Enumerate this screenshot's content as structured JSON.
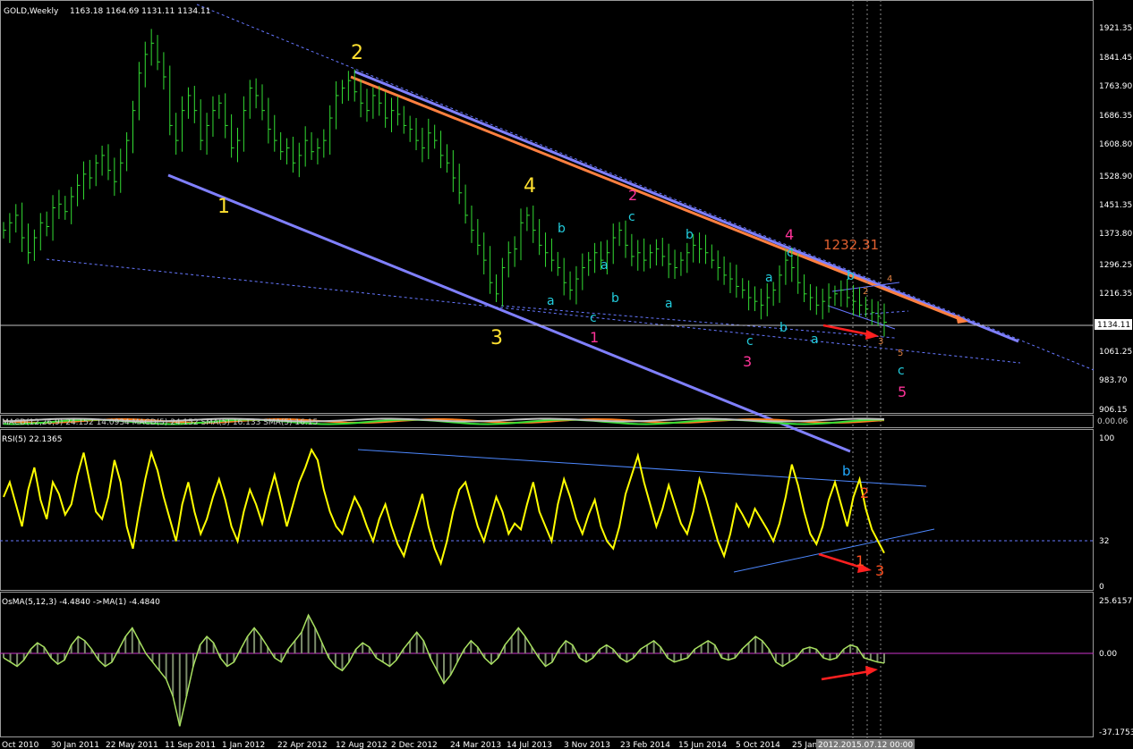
{
  "header": {
    "symbol": "GOLD,Weekly",
    "ohlc": "1163.18 1164.69 1131.11 1134.11"
  },
  "price_axis": {
    "ticks": [
      "1921.35",
      "1841.45",
      "1763.90",
      "1686.35",
      "1608.80",
      "1528.90",
      "1451.35",
      "1373.80",
      "1296.25",
      "1216.35",
      "1134.11",
      "1061.25",
      "983.70",
      "906.15"
    ],
    "current": "1134.11"
  },
  "price_annotation": "1232.31",
  "macd": {
    "label": "MACD(12,26,9) 24.152 14.0934 MACD(5) 24.152 SMA(5) 16.133 SMA(5) 16.15",
    "right_label": "0.00.06"
  },
  "rsi": {
    "label": "RSI(5) 22.1365",
    "ticks": [
      "100",
      "32",
      "0"
    ]
  },
  "osma": {
    "label": "OsMA(5,12,3) -4.4840 ->MA(1) -4.4840",
    "ticks": [
      "25.6157",
      "0.00",
      "-37.1753"
    ]
  },
  "x_axis": {
    "ticks": [
      "Oct 2010",
      "30 Jan 2011",
      "22 May 2011",
      "11 Sep 2011",
      "1 Jan 2012",
      "22 Apr 2012",
      "12 Aug 2012",
      "2 Dec 2012",
      "24 Mar 2013",
      "14 Jul 2013",
      "3 Nov 2013",
      "23 Feb 2014",
      "15 Jun 2014",
      "5 Oct 2014",
      "25 Jan",
      "2012.2015.07.12 00:00"
    ]
  },
  "wave_labels": {
    "yellow": [
      "1",
      "2",
      "3",
      "4"
    ],
    "magenta": [
      "1",
      "2",
      "3",
      "4",
      "5"
    ],
    "cyan": [
      "a",
      "b",
      "c",
      "a",
      "b",
      "c",
      "a",
      "b",
      "c",
      "a",
      "b",
      "c",
      "a",
      "b",
      "c",
      "b",
      "c"
    ],
    "orange": [
      "2",
      "3",
      "4",
      "5"
    ],
    "rsi": [
      "b",
      "2",
      "1",
      "3"
    ]
  },
  "colors": {
    "background": "#000000",
    "candles": "#33dd33",
    "channel": "#8080ff",
    "orange_line": "#ff8040",
    "rsi_line": "#ffff00",
    "osma_line": "#a8e060",
    "yellow_label": "#ffe030",
    "magenta_label": "#ff3399",
    "cyan_label": "#22ccdd",
    "arrow": "#ff2020"
  },
  "chart_data": [
    {
      "type": "candlestick",
      "title": "GOLD,Weekly",
      "y_range": [
        906.15,
        1921.35
      ],
      "series_name": "GOLD,Weekly",
      "closes": [
        1380,
        1400,
        1420,
        1360,
        1320,
        1360,
        1400,
        1390,
        1440,
        1450,
        1430,
        1470,
        1500,
        1530,
        1520,
        1560,
        1580,
        1540,
        1510,
        1560,
        1620,
        1700,
        1800,
        1850,
        1880,
        1830,
        1790,
        1660,
        1620,
        1700,
        1740,
        1700,
        1620,
        1660,
        1700,
        1720,
        1660,
        1600,
        1620,
        1700,
        1760,
        1740,
        1700,
        1650,
        1620,
        1590,
        1600,
        1560,
        1580,
        1620,
        1590,
        1600,
        1620,
        1680,
        1740,
        1760,
        1780,
        1750,
        1720,
        1700,
        1740,
        1720,
        1680,
        1700,
        1690,
        1660,
        1650,
        1620,
        1600,
        1640,
        1620,
        1580,
        1560,
        1520,
        1480,
        1420,
        1380,
        1340,
        1300,
        1240,
        1210,
        1280,
        1320,
        1330,
        1400,
        1420,
        1380,
        1340,
        1320,
        1300,
        1280,
        1240,
        1220,
        1250,
        1280,
        1300,
        1320,
        1300,
        1320,
        1360,
        1380,
        1340,
        1310,
        1320,
        1300,
        1320,
        1330,
        1310,
        1290,
        1280,
        1300,
        1320,
        1340,
        1330,
        1320,
        1300,
        1280,
        1260,
        1250,
        1230,
        1220,
        1200,
        1190,
        1180,
        1200,
        1220,
        1260,
        1300,
        1280,
        1240,
        1210,
        1200,
        1180,
        1190,
        1200,
        1210,
        1220,
        1200,
        1190,
        1180,
        1170,
        1160,
        1150,
        1134.11
      ]
    },
    {
      "type": "line",
      "title": "RSI(5) 22.1365",
      "y_range": [
        0,
        100
      ],
      "series_name": "RSI(5)",
      "values": [
        60,
        70,
        55,
        40,
        65,
        80,
        58,
        45,
        70,
        62,
        48,
        55,
        75,
        90,
        70,
        50,
        45,
        60,
        85,
        70,
        40,
        25,
        50,
        72,
        90,
        78,
        60,
        45,
        30,
        55,
        70,
        50,
        35,
        45,
        60,
        72,
        58,
        40,
        30,
        50,
        65,
        55,
        42,
        60,
        75,
        58,
        40,
        55,
        70,
        80,
        92,
        85,
        65,
        50,
        40,
        35,
        48,
        60,
        52,
        40,
        30,
        45,
        55,
        40,
        28,
        20,
        35,
        48,
        62,
        40,
        25,
        15,
        30,
        50,
        65,
        70,
        55,
        40,
        30,
        45,
        60,
        50,
        35,
        42,
        38,
        55,
        70,
        50,
        40,
        30,
        55,
        72,
        60,
        45,
        35,
        48,
        58,
        40,
        30,
        25,
        40,
        62,
        75,
        88,
        70,
        55,
        40,
        52,
        68,
        55,
        42,
        35,
        50,
        72,
        60,
        45,
        30,
        20,
        35,
        55,
        48,
        40,
        52,
        45,
        38,
        30,
        42,
        60,
        82,
        68,
        50,
        35,
        28,
        40,
        58,
        70,
        55,
        40,
        60,
        72,
        52,
        38,
        30,
        22
      ]
    },
    {
      "type": "bar",
      "title": "OsMA(5,12,3) -4.4840",
      "y_range": [
        -37.1753,
        25.6157
      ],
      "series_name": "OsMA(5,12,3)",
      "values": [
        -2,
        -4,
        -6,
        -3,
        2,
        5,
        3,
        -2,
        -5,
        -3,
        4,
        8,
        6,
        2,
        -3,
        -6,
        -4,
        2,
        8,
        12,
        6,
        0,
        -4,
        -8,
        -12,
        -20,
        -34,
        -20,
        -6,
        4,
        8,
        5,
        -2,
        -6,
        -4,
        2,
        8,
        12,
        8,
        3,
        -2,
        -4,
        2,
        6,
        10,
        18,
        12,
        5,
        -2,
        -6,
        -8,
        -4,
        2,
        5,
        3,
        -2,
        -4,
        -6,
        -3,
        2,
        6,
        10,
        6,
        -2,
        -8,
        -14,
        -10,
        -4,
        2,
        6,
        3,
        -2,
        -5,
        -2,
        4,
        8,
        12,
        8,
        3,
        -2,
        -6,
        -4,
        2,
        6,
        4,
        -2,
        -4,
        -2,
        2,
        4,
        2,
        -2,
        -4,
        -2,
        2,
        4,
        6,
        3,
        -2,
        -4,
        -3,
        -2,
        2,
        4,
        6,
        4,
        -2,
        -3,
        -2,
        2,
        5,
        8,
        6,
        2,
        -4,
        -6,
        -4,
        -2,
        2,
        3,
        2,
        -2,
        -3,
        -2,
        2,
        4,
        3,
        -2,
        -3,
        -4,
        -4.484
      ]
    }
  ]
}
